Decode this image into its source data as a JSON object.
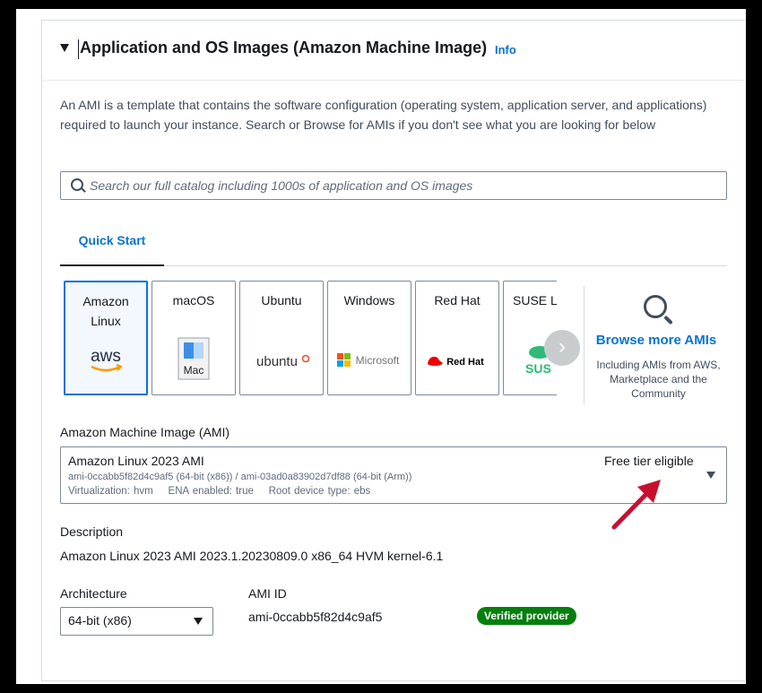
{
  "section": {
    "title": "Application and OS Images (Amazon Machine Image)",
    "info_link": "Info",
    "description": "An AMI is a template that contains the software configuration (operating system, application server, and applications) required to launch your instance. Search or Browse for AMIs if you don't see what you are looking for below"
  },
  "search": {
    "placeholder": "Search our full catalog including 1000s of application and OS images"
  },
  "tabs": [
    {
      "label": "Quick Start",
      "selected": true
    }
  ],
  "tiles": [
    {
      "label": "Amazon Linux",
      "logo": "aws",
      "selected": true
    },
    {
      "label": "macOS",
      "logo": "Mac",
      "selected": false
    },
    {
      "label": "Ubuntu",
      "logo": "ubuntu",
      "selected": false
    },
    {
      "label": "Windows",
      "logo": "Microsoft",
      "selected": false
    },
    {
      "label": "Red Hat",
      "logo": "Red Hat",
      "selected": false
    },
    {
      "label": "SUSE Li",
      "logo": "SUS",
      "selected": false
    }
  ],
  "browse": {
    "title": "Browse more AMIs",
    "subtitle": "Including AMIs from AWS, Marketplace and the Community"
  },
  "ami": {
    "label": "Amazon Machine Image (AMI)",
    "name": "Amazon Linux 2023 AMI",
    "ids": "ami-0ccabb5f82d4c9af5 (64-bit (x86)) / ami-03ad0a83902d7df88 (64-bit (Arm))",
    "virtualization": "Virtualization: hvm",
    "ena": "ENA enabled: true",
    "root_device": "Root device type: ebs",
    "free_tier": "Free tier eligible"
  },
  "details": {
    "description_label": "Description",
    "description_value": "Amazon Linux 2023 AMI 2023.1.20230809.0 x86_64 HVM kernel-6.1",
    "architecture_label": "Architecture",
    "architecture_value": "64-bit (x86)",
    "ami_id_label": "AMI ID",
    "ami_id_value": "ami-0ccabb5f82d4c9af5",
    "verified_badge": "Verified provider"
  },
  "colors": {
    "link": "#0972d3",
    "badge": "#037f0c",
    "annotation_arrow": "#c8102e",
    "background": "#000000"
  }
}
